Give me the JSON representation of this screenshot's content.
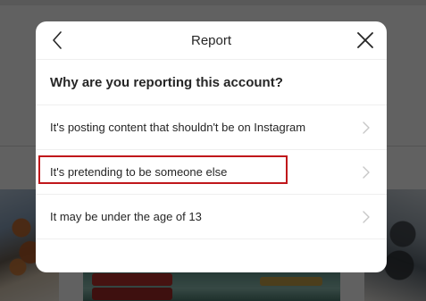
{
  "modal": {
    "title": "Report",
    "question": "Why are you reporting this account?",
    "options": [
      {
        "label": "It's posting content that shouldn't be on Instagram"
      },
      {
        "label": "It's pretending to be someone else"
      },
      {
        "label": "It may be under the age of 13"
      }
    ]
  },
  "icons": {
    "back": "chevron-left-icon",
    "close": "close-icon",
    "option_arrow": "chevron-right-icon"
  },
  "colors": {
    "highlight": "#c0171b",
    "overlay": "rgba(0,0,0,0.62)",
    "text": "#262626",
    "chevron": "#c7c7c7"
  }
}
